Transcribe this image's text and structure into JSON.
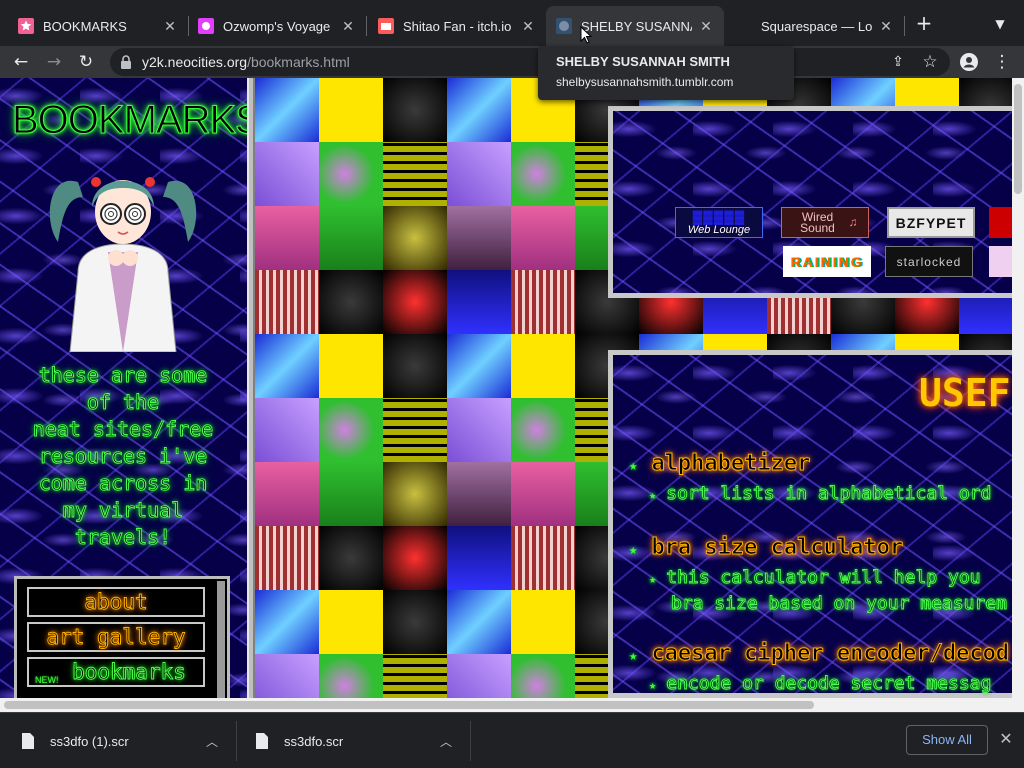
{
  "browser": {
    "tabs": [
      {
        "title": "BOOKMARKS",
        "active": false
      },
      {
        "title": "Ozwomp's Voyage b",
        "active": false
      },
      {
        "title": "Shitao Fan - itch.io",
        "active": false
      },
      {
        "title": "SHELBY SUSANNAH",
        "active": true
      },
      {
        "title": "Squarespace — Log",
        "active": false
      }
    ],
    "url_host": "y2k.neocities.org",
    "url_path": "/bookmarks.html",
    "tooltip": {
      "title": "SHELBY SUSANNAH SMITH",
      "subtitle": "shelbysusannahsmith.tumblr.com"
    }
  },
  "page": {
    "heading": "BOOKMARKS",
    "blurb_lines": [
      "these are some",
      "of the",
      "neat sites/free",
      "resources i've",
      "come across in",
      "my virtual",
      "travels!"
    ],
    "nav": [
      {
        "label": "about",
        "color": "orange"
      },
      {
        "label": "art gallery",
        "color": "orange"
      },
      {
        "label": "bookmarks",
        "color": "green",
        "badge": "NEW!"
      }
    ],
    "buttons": [
      {
        "label": "Web Lounge"
      },
      {
        "label": "Wired Sound"
      },
      {
        "label": "BZFYPET"
      },
      {
        "label": "RAINING"
      },
      {
        "label": "starlocked"
      }
    ],
    "useful_title": "USEF",
    "links": [
      {
        "name": "alphabetizer",
        "desc": [
          "sort lists in alphabetical ord"
        ]
      },
      {
        "name": "bra size calculator",
        "desc": [
          "this calculator will help you",
          "bra size based on your measurem"
        ]
      },
      {
        "name": "caesar cipher encoder/decod",
        "desc": [
          "encode or decode secret messag"
        ]
      }
    ]
  },
  "downloads": {
    "items": [
      {
        "name": "ss3dfo (1).scr"
      },
      {
        "name": "ss3dfo.scr"
      }
    ],
    "show_all": "Show All"
  },
  "colors": {
    "neon_green": "#3cff3c",
    "neon_orange": "#ffb000",
    "electric_blue": "#050048"
  }
}
